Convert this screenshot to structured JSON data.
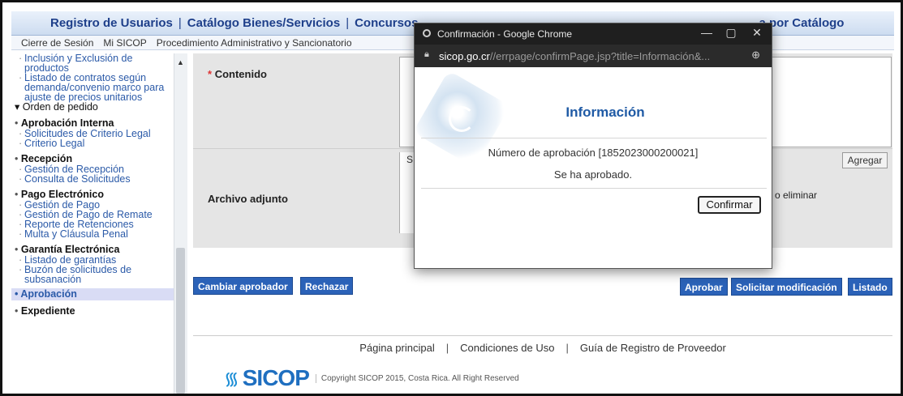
{
  "topnav": {
    "items": [
      "Registro de Usuarios",
      "Catálogo Bienes/Servicios",
      "Concursos"
    ],
    "tail": "a por Catálogo"
  },
  "subnav": {
    "items": [
      "Cierre de Sesión",
      "Mi SICOP",
      "Procedimiento Administrativo y Sancionatorio"
    ]
  },
  "sidebar": {
    "top_items": [
      "Inclusión y Exclusión de productos",
      "Listado de contratos según demanda/convenio marco para ajuste de precios unitarios"
    ],
    "order": "Orden de pedido",
    "sections": [
      {
        "title": "Aprobación Interna",
        "items": [
          "Solicitudes de Criterio Legal",
          "Criterio Legal"
        ]
      },
      {
        "title": "Recepción",
        "items": [
          "Gestión de Recepción",
          "Consulta de Solicitudes"
        ]
      },
      {
        "title": "Pago Electrónico",
        "items": [
          "Gestión de Pago",
          "Gestión de Pago de Remate",
          "Reporte de Retenciones",
          "Multa y Cláusula Penal"
        ]
      },
      {
        "title": "Garantía Electrónica",
        "items": [
          "Listado de garantías",
          "Buzón de solicitudes de subsanación"
        ]
      }
    ],
    "active": "Aprobación",
    "last": "Expediente"
  },
  "form": {
    "contenido_label": "Contenido",
    "required_mark": "*",
    "archivo_label": "Archivo adjunto",
    "agregar": "Agregar",
    "eliminar": "o eliminar",
    "attach_letter": "S"
  },
  "buttons": {
    "cambiar": "Cambiar aprobador",
    "rechazar": "Rechazar",
    "aprobar": "Aprobar",
    "solicitar": "Solicitar modificación",
    "listado": "Listado"
  },
  "footer": {
    "links": [
      "Página principal",
      "Condiciones de Uso",
      "Guía de Registro de Proveedor"
    ],
    "logo": "SICOP",
    "copyright": "Copyright SICOP 2015, Costa Rica. All Right Reserved"
  },
  "popup": {
    "window_title": "Confirmación - Google Chrome",
    "url_host": "sicop.go.cr",
    "url_path": "//errpage/confirmPage.jsp?title=Información&...",
    "heading": "Información",
    "number_text": "Número de aprobación [1852023000200021]",
    "message": "Se ha aprobado.",
    "confirm": "Confirmar"
  },
  "colors": {
    "nav_text": "#1e3f8a",
    "button_blue": "#2b62b8",
    "link_blue": "#2b5aa8",
    "popup_titlebar": "#1f1f1f"
  }
}
